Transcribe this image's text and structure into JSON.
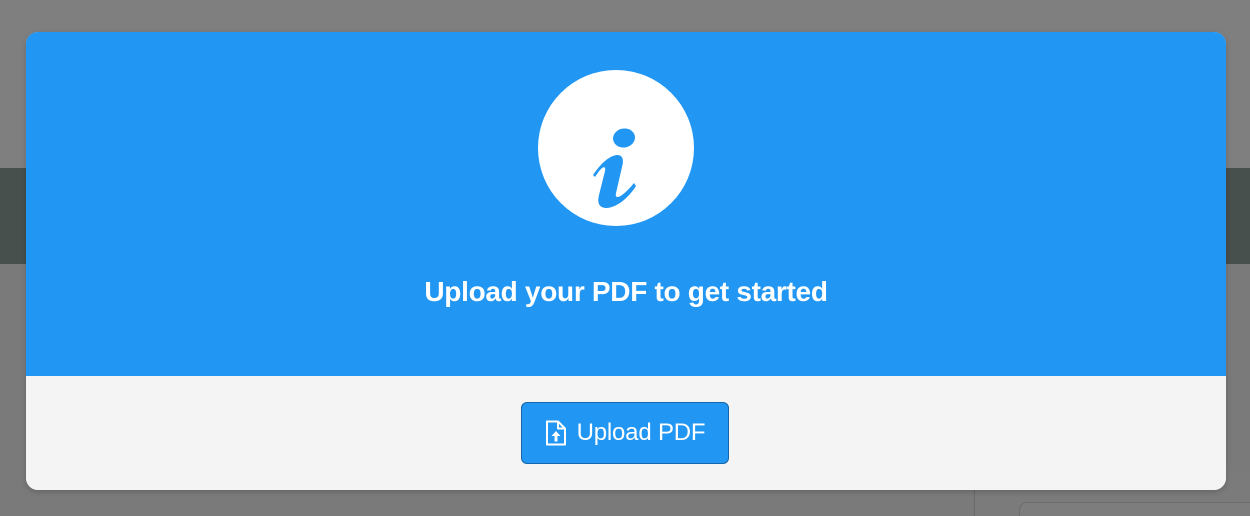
{
  "modal": {
    "title": "Upload your PDF to get started",
    "header_icon": "info-icon",
    "upload_button": {
      "label": "Upload PDF",
      "icon": "file-upload-icon"
    }
  },
  "colors": {
    "accent": "#2196f3",
    "footer_background": "#f4f4f4",
    "overlay": "#7f7f7f"
  }
}
